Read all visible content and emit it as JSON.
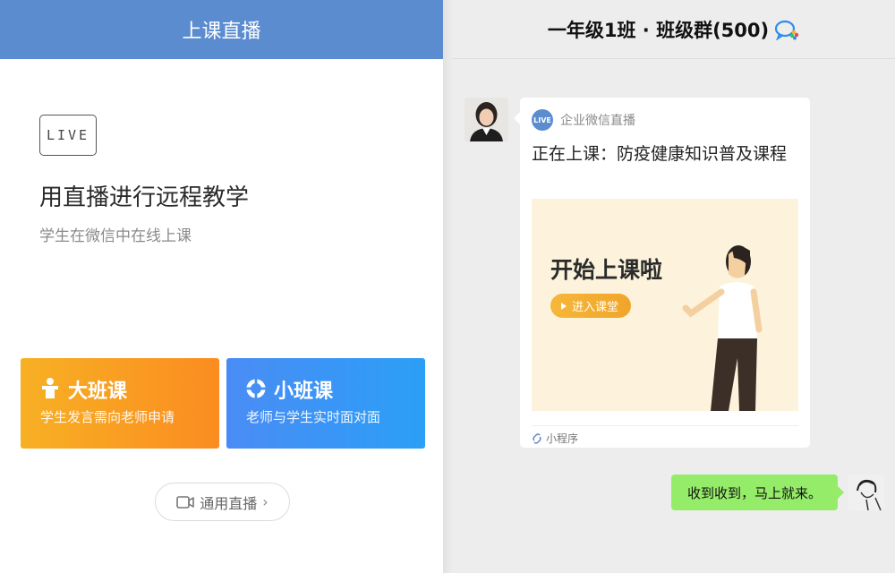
{
  "left": {
    "header_title": "上课直播",
    "live_badge": "LIVE",
    "hero_title": "用直播进行远程教学",
    "hero_subtitle": "学生在微信中在线上课",
    "cards": [
      {
        "title": "大班课",
        "desc": "学生发言需向老师申请",
        "icon": "podium-icon",
        "color_start": "#f7b024",
        "color_end": "#fb8c20"
      },
      {
        "title": "小班课",
        "desc": "老师与学生实时面对面",
        "icon": "ring-icon",
        "color_start": "#4a8cf5",
        "color_end": "#2b9ff6"
      }
    ],
    "general_button": "通用直播",
    "accent_color": "#5b8ccf"
  },
  "chat": {
    "title": "一年级1班 · 班级群(500)",
    "card": {
      "source_badge": "LIVE",
      "source_name": "企业微信直播",
      "title": "正在上课：防疫健康知识普及课程",
      "banner_text": "开始上课啦",
      "enter_button": "进入课堂",
      "footer": "小程序"
    },
    "reply": "收到收到，马上就来。",
    "reply_color": "#95ec69"
  }
}
